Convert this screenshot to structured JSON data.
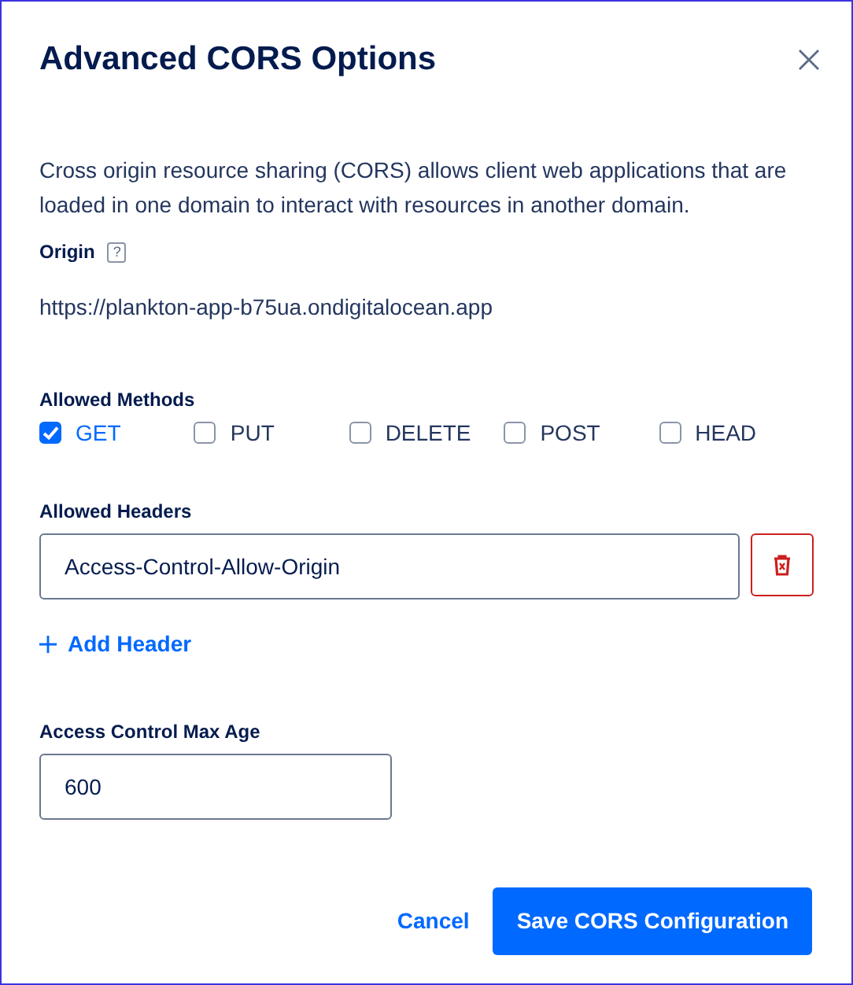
{
  "dialog": {
    "title": "Advanced CORS Options"
  },
  "description": "Cross origin resource sharing (CORS) allows client web applications that are loaded in one domain to interact with resources in another domain.",
  "origin": {
    "label": "Origin",
    "help": "?",
    "value": "https://plankton-app-b75ua.ondigitalocean.app"
  },
  "allowed_methods": {
    "label": "Allowed Methods",
    "options": [
      {
        "label": "GET",
        "checked": true
      },
      {
        "label": "PUT",
        "checked": false
      },
      {
        "label": "DELETE",
        "checked": false
      },
      {
        "label": "POST",
        "checked": false
      },
      {
        "label": "HEAD",
        "checked": false
      }
    ]
  },
  "allowed_headers": {
    "label": "Allowed Headers",
    "headers": [
      {
        "value": "Access-Control-Allow-Origin"
      }
    ],
    "add_label": "Add Header"
  },
  "max_age": {
    "label": "Access Control Max Age",
    "value": "600"
  },
  "buttons": {
    "cancel": "Cancel",
    "save": "Save CORS Configuration"
  }
}
